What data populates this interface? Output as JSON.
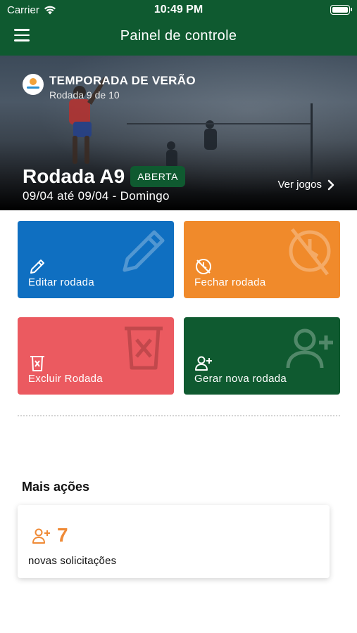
{
  "status_bar": {
    "carrier": "Carrier",
    "time": "10:49 PM"
  },
  "header": {
    "title": "Painel de controle"
  },
  "hero": {
    "season_title": "TEMPORADA DE VERÃO",
    "season_subtitle": "Rodada 9 de 10",
    "round_title": "Rodada A9",
    "status_badge": "ABERTA",
    "dates": "09/04 até 09/04 - Domingo",
    "see_games": "Ver jogos"
  },
  "actions": {
    "edit": "Editar rodada",
    "close": "Fechar rodada",
    "delete": "Excluir Rodada",
    "new": "Gerar nova rodada"
  },
  "more": {
    "title": "Mais ações",
    "count": "7",
    "label": "novas solicitações"
  },
  "colors": {
    "brand_green": "#0f5a30",
    "blue": "#0f6fc1",
    "orange": "#f08a2b",
    "red": "#eb5a60",
    "accent_orange": "#ef8a36"
  }
}
